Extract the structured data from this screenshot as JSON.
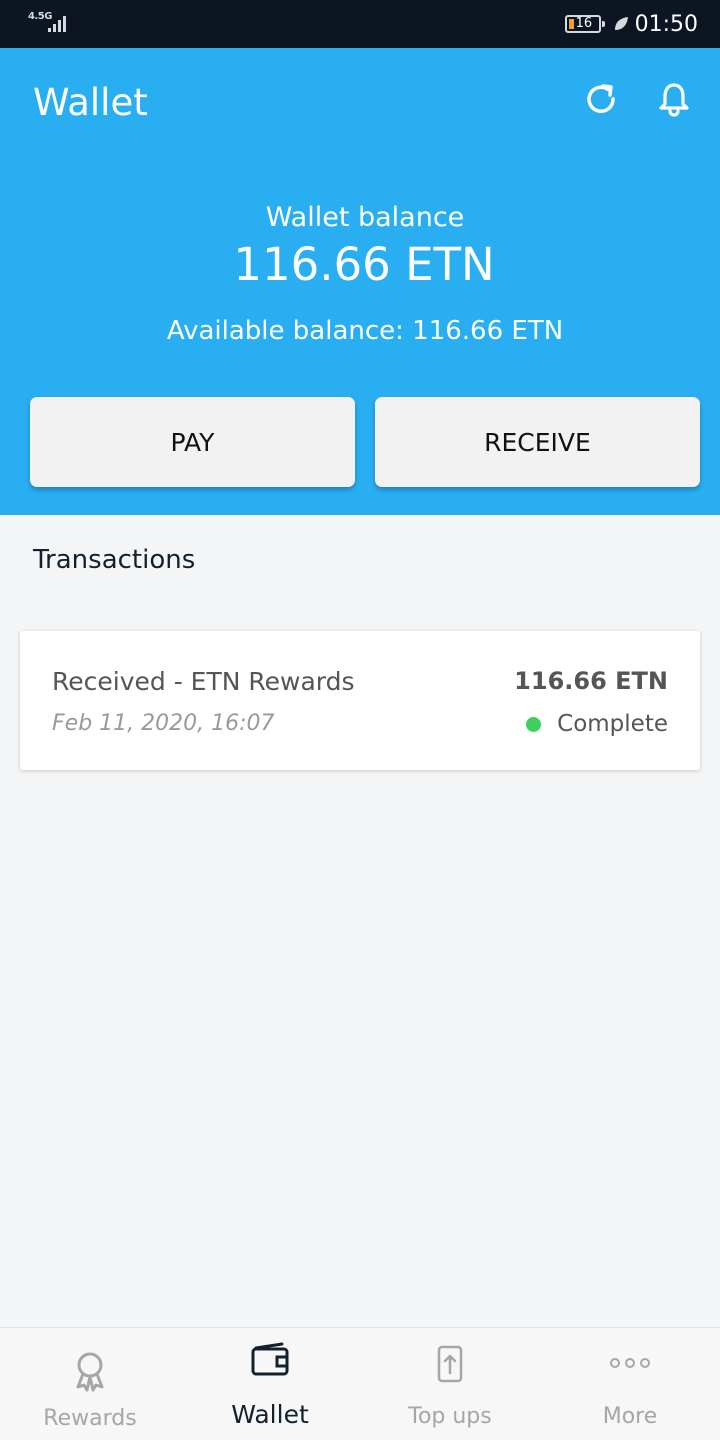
{
  "status_bar": {
    "network": "4.5G",
    "battery": "16",
    "time": "01:50"
  },
  "header": {
    "title": "Wallet",
    "balance_label": "Wallet balance",
    "balance_value": "116.66 ETN",
    "available_balance": "Available balance: 116.66 ETN",
    "pay_label": "PAY",
    "receive_label": "RECEIVE"
  },
  "transactions": {
    "heading": "Transactions",
    "items": [
      {
        "title": "Received - ETN Rewards",
        "date": "Feb 11, 2020, 16:07",
        "amount": "116.66 ETN",
        "status": "Complete",
        "status_color": "#3ecf5c"
      }
    ]
  },
  "bottom_nav": {
    "items": [
      {
        "label": "Rewards",
        "icon": "award-icon"
      },
      {
        "label": "Wallet",
        "icon": "wallet-icon"
      },
      {
        "label": "Top ups",
        "icon": "top-up-icon"
      },
      {
        "label": "More",
        "icon": "more-icon"
      }
    ]
  },
  "colors": {
    "header_background": "#2aaef2",
    "status_bar_background": "#0c1521"
  }
}
